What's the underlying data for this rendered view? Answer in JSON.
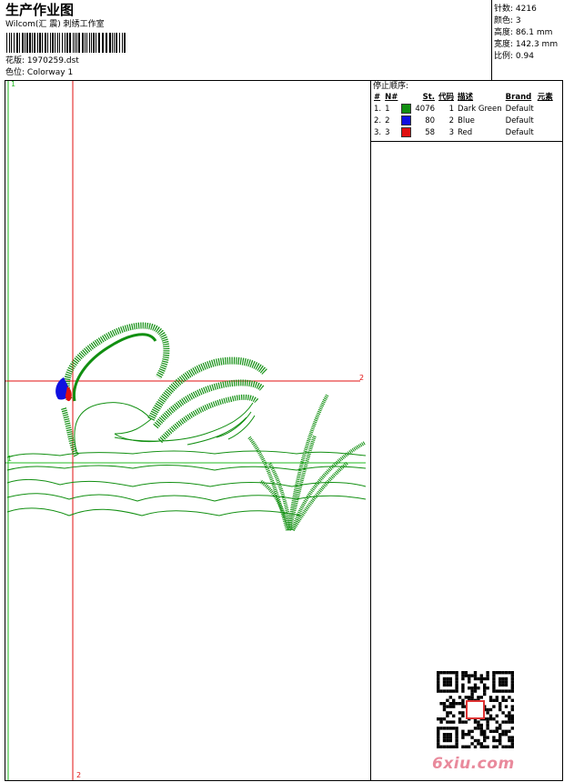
{
  "header": {
    "title": "生产作业图",
    "company": "Wilcom(汇 震) 刺绣工作室",
    "design_label": "花版:",
    "design_value": "1970259.dst",
    "colorway_label": "色位:",
    "colorway_value": "Colorway 1"
  },
  "stats": [
    {
      "label": "针数:",
      "value": "4216"
    },
    {
      "label": "颜色:",
      "value": "3"
    },
    {
      "label": "高度:",
      "value": "86.1 mm"
    },
    {
      "label": "宽度:",
      "value": "142.3 mm"
    },
    {
      "label": "比例:",
      "value": "0.94"
    }
  ],
  "stop_sequence": {
    "title": "停止顺序:",
    "columns": [
      "#",
      "N#",
      "St.",
      "代码",
      "描述",
      "Brand",
      "元素"
    ],
    "rows": [
      {
        "idx": "1.",
        "n": "1",
        "color": "#118f11",
        "stitches": "4076",
        "code": "1",
        "desc": "Dark Green",
        "brand": "Default"
      },
      {
        "idx": "2.",
        "n": "2",
        "color": "#1010e0",
        "stitches": "80",
        "code": "2",
        "desc": "Blue",
        "brand": "Default"
      },
      {
        "idx": "3.",
        "n": "3",
        "color": "#e01010",
        "stitches": "58",
        "code": "3",
        "desc": "Red",
        "brand": "Default"
      }
    ]
  },
  "guides": {
    "green_marker_top": "1",
    "green_marker_mid": "1",
    "red_marker_right": "2",
    "red_marker_bottom": "2"
  },
  "colors": {
    "thread_green": "#118f11",
    "thread_blue": "#1010e0",
    "thread_red": "#e01010",
    "guide_red": "#e01010",
    "guide_green": "#22bb22"
  },
  "watermark": "6xiu.com"
}
